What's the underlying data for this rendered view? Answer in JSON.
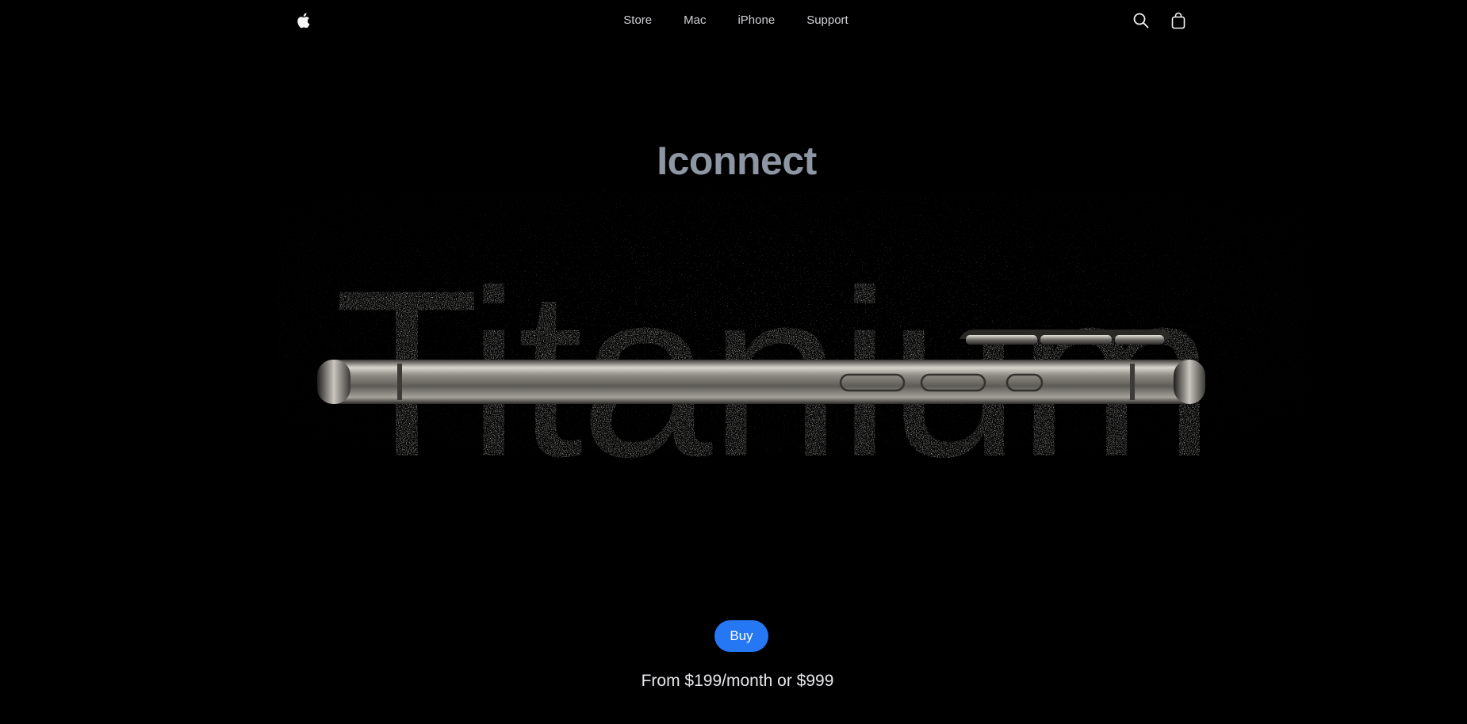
{
  "nav": {
    "logo_icon": "apple-logo-icon",
    "links": [
      {
        "label": "Store"
      },
      {
        "label": "Mac"
      },
      {
        "label": "iPhone"
      },
      {
        "label": "Support"
      }
    ],
    "search_icon": "search-icon",
    "bag_icon": "bag-icon"
  },
  "hero": {
    "title": "Iconnect",
    "wordmark": "Titanium",
    "image_subject": "titanium iPhone side profile"
  },
  "cta": {
    "buy_label": "Buy",
    "price_text": "From $199/month or $999"
  },
  "colors": {
    "background": "#000000",
    "title": "#8e96a3",
    "button": "#2577f3",
    "nav_text": "#d2d2d7"
  }
}
